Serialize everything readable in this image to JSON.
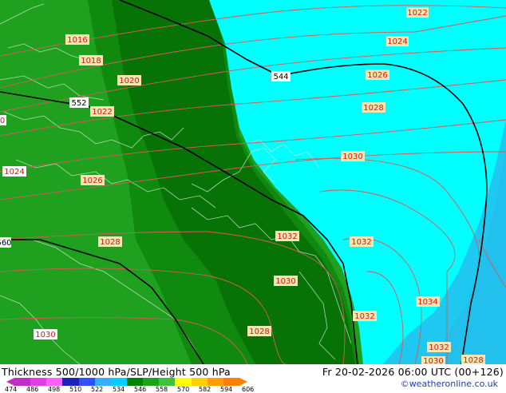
{
  "colors": {
    "green_light": "#1fa11f",
    "green_mid": "#0f8a0f",
    "green_dark": "#077307",
    "cyan": "#00ffff",
    "cyan_light": "#22eaf2",
    "blue_sea": "#1ec8f0",
    "isobar": "#d85a5a",
    "label_bg": "#f0e0a0"
  },
  "map": {
    "thickness_labels": [
      "544",
      "552",
      "560"
    ],
    "isobar_labels": [
      {
        "text": "1022",
        "bg": "peach"
      },
      {
        "text": "1024",
        "bg": "peach"
      },
      {
        "text": "1026",
        "bg": "peach"
      },
      {
        "text": "1028",
        "bg": "peach"
      },
      {
        "text": "1030",
        "bg": "peach"
      },
      {
        "text": "1032",
        "bg": "peach"
      },
      {
        "text": "1034",
        "bg": "peach"
      },
      {
        "text": "1032",
        "bg": "peach"
      },
      {
        "text": "1030",
        "bg": "peach"
      },
      {
        "text": "1028",
        "bg": "peach"
      },
      {
        "text": "1016",
        "bg": "peach"
      },
      {
        "text": "1018",
        "bg": "peach"
      },
      {
        "text": "1020",
        "bg": "peach"
      },
      {
        "text": "1022",
        "bg": "peach"
      },
      {
        "text": "1024",
        "bg": "white"
      },
      {
        "text": "1026",
        "bg": "peach"
      },
      {
        "text": "1028",
        "bg": "peach"
      },
      {
        "text": "1030",
        "bg": "white"
      },
      {
        "text": "1028",
        "bg": "peach"
      },
      {
        "text": "1030",
        "bg": "peach"
      },
      {
        "text": "1032",
        "bg": "peach"
      },
      {
        "text": "1032",
        "bg": "peach"
      },
      {
        "text": "1032",
        "bg": "peach"
      },
      {
        "text": "0",
        "bg": "white"
      }
    ]
  },
  "footer": {
    "title": "Thickness 500/1000 hPa/SLP/Height 500 hPa",
    "valid_time": "Fr 20-02-2026 06:00 UTC (00+126)",
    "credit": "©weatheronline.co.uk",
    "scale_ticks": [
      "474",
      "486",
      "498",
      "510",
      "522",
      "534",
      "546",
      "558",
      "570",
      "582",
      "594",
      "606"
    ],
    "scale_colors": [
      "#c030c0",
      "#e040e0",
      "#ff60ff",
      "#2020c0",
      "#3050ff",
      "#30b0ff",
      "#00d0ff",
      "#008000",
      "#20a020",
      "#40c040",
      "#ffff00",
      "#ffd000",
      "#ffa000",
      "#ff8000"
    ]
  }
}
